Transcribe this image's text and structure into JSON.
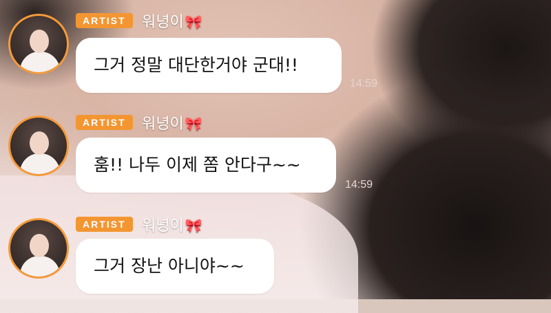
{
  "messages": [
    {
      "badge": "ARTIST",
      "name": "워녕이",
      "text": "그거 정말 대단한거야 군대!!",
      "time": "14:59"
    },
    {
      "badge": "ARTIST",
      "name": "워녕이",
      "text": "훔!! 나두 이제 쫌 안다구~~",
      "time": "14:59"
    },
    {
      "badge": "ARTIST",
      "name": "워녕이",
      "text": "그거 장난 아니야~~",
      "time": ""
    }
  ],
  "icons": {
    "name_decoration": "ribbon-bow-icon"
  },
  "colors": {
    "badge": "#f39632",
    "avatar_ring": "#f59a3a",
    "bubble": "#ffffff"
  }
}
